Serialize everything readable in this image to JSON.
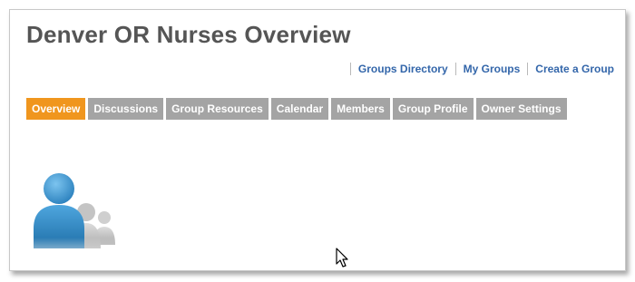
{
  "page": {
    "title": "Denver OR Nurses Overview"
  },
  "top_links": [
    {
      "label": "Groups Directory"
    },
    {
      "label": "My Groups"
    },
    {
      "label": "Create a Group"
    }
  ],
  "tabs": [
    {
      "label": "Overview",
      "active": true
    },
    {
      "label": "Discussions",
      "active": false
    },
    {
      "label": "Group Resources",
      "active": false
    },
    {
      "label": "Calendar",
      "active": false
    },
    {
      "label": "Members",
      "active": false
    },
    {
      "label": "Group Profile",
      "active": false
    },
    {
      "label": "Owner Settings",
      "active": false
    }
  ],
  "avatar": {
    "icon": "group-avatar-icon"
  },
  "colors": {
    "active_tab": "#f0961e",
    "inactive_tab": "#a4a4a4",
    "link": "#3366aa",
    "title": "#555555",
    "avatar_primary": "#2e86c1"
  }
}
